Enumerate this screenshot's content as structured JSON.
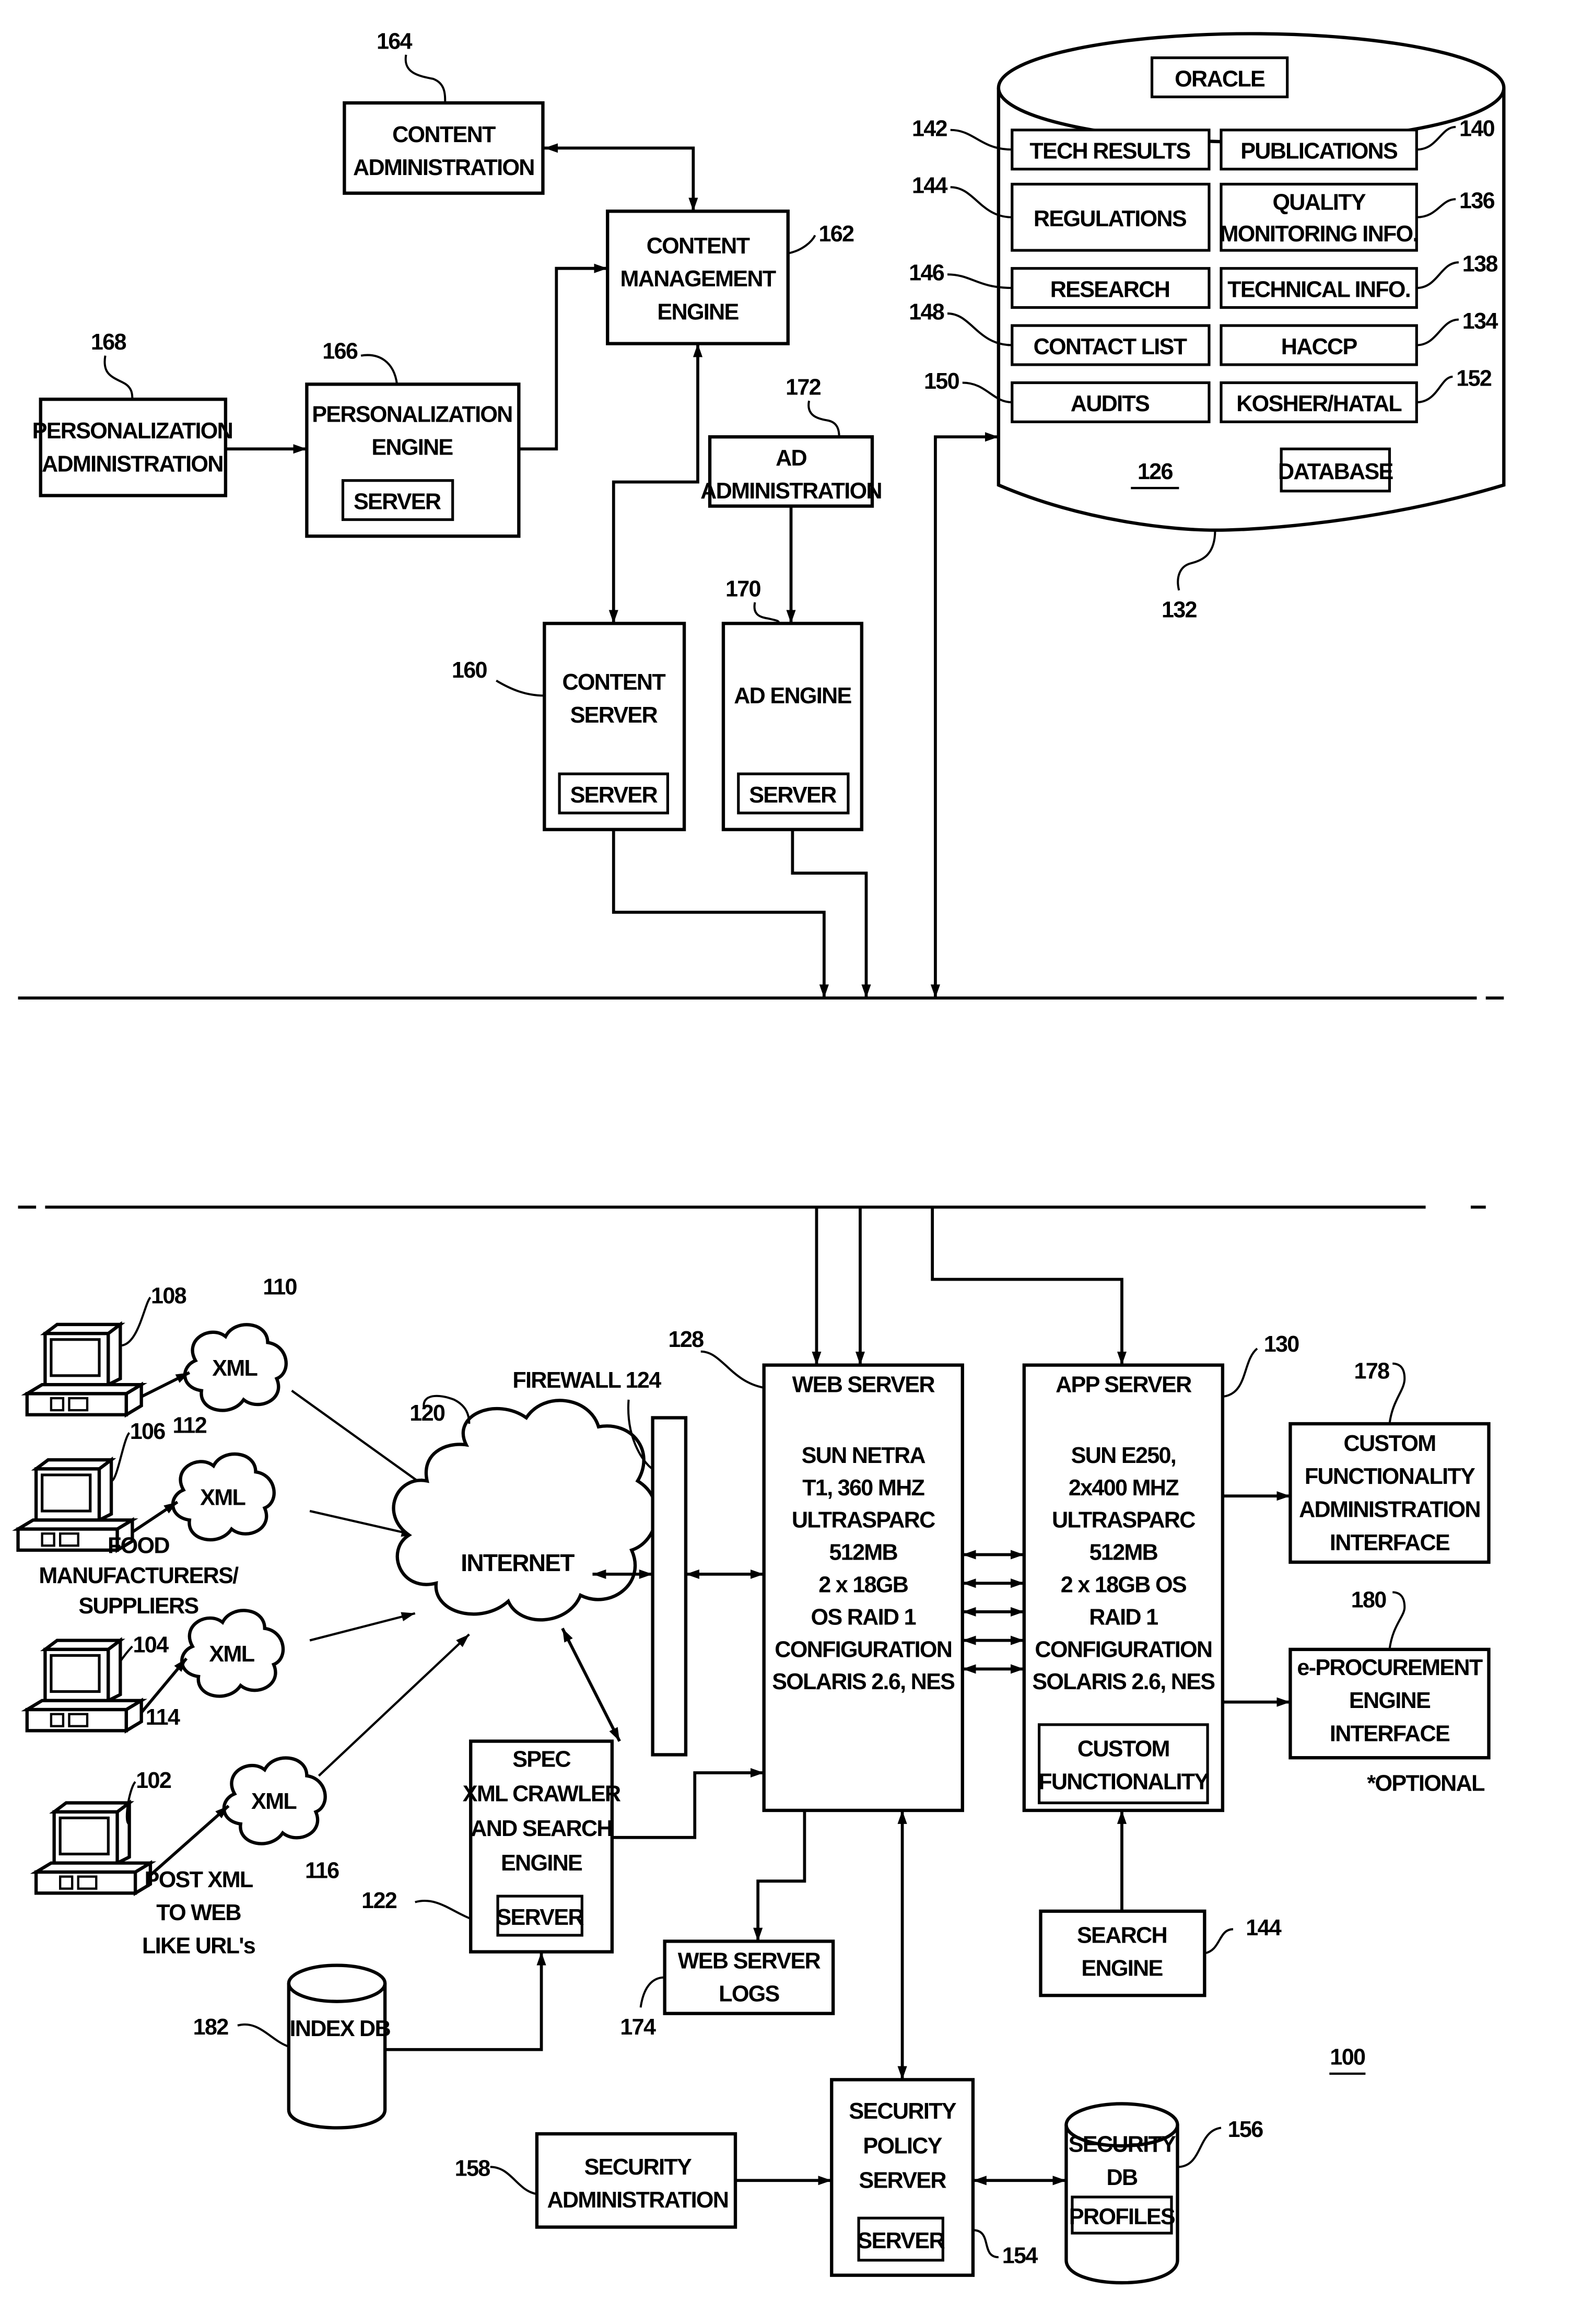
{
  "figure_number": "100",
  "upper": {
    "content_administration": {
      "ref": "164",
      "lines": [
        "CONTENT",
        "ADMINISTRATION"
      ]
    },
    "content_management_engine": {
      "ref": "162",
      "lines": [
        "CONTENT",
        "MANAGEMENT",
        "ENGINE"
      ]
    },
    "personalization_administration": {
      "ref": "168",
      "lines": [
        "PERSONALIZATION",
        "ADMINISTRATION"
      ]
    },
    "personalization_engine": {
      "ref": "166",
      "lines": [
        "PERSONALIZATION",
        "ENGINE"
      ],
      "server_label": "SERVER"
    },
    "ad_administration": {
      "ref": "172",
      "lines": [
        "AD",
        "ADMINISTRATION"
      ]
    },
    "content_server": {
      "ref": "160",
      "lines": [
        "CONTENT",
        "SERVER"
      ],
      "server_label": "SERVER"
    },
    "ad_engine": {
      "ref": "170",
      "lines": [
        "AD ENGINE"
      ],
      "server_label": "SERVER"
    },
    "database": {
      "ref": "126",
      "cylinder_ref": "132",
      "top_label": "ORACLE",
      "bottom_label": "DATABASE",
      "left_items": [
        {
          "label": [
            "TECH RESULTS"
          ],
          "ref": "142"
        },
        {
          "label": [
            "REGULATIONS"
          ],
          "ref": "144"
        },
        {
          "label": [
            "RESEARCH"
          ],
          "ref": "146"
        },
        {
          "label": [
            "CONTACT LIST"
          ],
          "ref": "148"
        },
        {
          "label": [
            "AUDITS"
          ],
          "ref": "150"
        }
      ],
      "right_items": [
        {
          "label": [
            "PUBLICATIONS"
          ],
          "ref": "140"
        },
        {
          "label": [
            "QUALITY",
            "MONITORING INFO."
          ],
          "ref": "136"
        },
        {
          "label": [
            "TECHNICAL INFO."
          ],
          "ref": "138"
        },
        {
          "label": [
            "HACCP"
          ],
          "ref": "134"
        },
        {
          "label": [
            "KOSHER/HATAL"
          ],
          "ref": "152"
        }
      ]
    }
  },
  "lower": {
    "clients": [
      {
        "ref": "108",
        "cloud_ref": "110",
        "cloud_label": "XML"
      },
      {
        "ref": "106",
        "cloud_ref": "112",
        "cloud_label": "XML"
      },
      {
        "ref": "104",
        "cloud_ref": "114",
        "cloud_label": "XML"
      },
      {
        "ref": "102",
        "cloud_ref": "116",
        "cloud_label": "XML"
      }
    ],
    "food_label": [
      "FOOD",
      "MANUFACTURERS/",
      "SUPPLIERS"
    ],
    "post_label": [
      "POST XML",
      "TO WEB",
      "LIKE URL's"
    ],
    "internet": {
      "ref": "120",
      "label": "INTERNET"
    },
    "firewall": {
      "label": "FIREWALL 124"
    },
    "web_server": {
      "ref": "128",
      "title": "WEB SERVER",
      "specs": [
        "SUN NETRA",
        "T1, 360 MHZ",
        "ULTRASPARC",
        "512MB",
        "2 x 18GB",
        "OS RAID 1",
        "CONFIGURATION",
        "SOLARIS 2.6, NES"
      ]
    },
    "app_server": {
      "ref": "130",
      "title": "APP SERVER",
      "specs": [
        "SUN E250,",
        "2x400 MHZ",
        "ULTRASPARC",
        "512MB",
        "2 x 18GB OS",
        "RAID 1",
        "CONFIGURATION",
        "SOLARIS 2.6, NES"
      ],
      "custom_label": [
        "CUSTOM",
        "FUNCTIONALITY"
      ]
    },
    "custom_admin": {
      "ref": "178",
      "lines": [
        "CUSTOM",
        "FUNCTIONALITY",
        "ADMINISTRATION",
        "INTERFACE"
      ]
    },
    "eprocurement": {
      "ref": "180",
      "lines": [
        "e-PROCUREMENT",
        "ENGINE",
        "INTERFACE"
      ],
      "note": "*OPTIONAL"
    },
    "spec_crawler": {
      "ref": "122",
      "lines": [
        "SPEC",
        "XML CRAWLER",
        "AND SEARCH",
        "ENGINE"
      ],
      "server_label": "SERVER"
    },
    "index_db": {
      "ref": "182",
      "label": "INDEX DB"
    },
    "web_server_logs": {
      "ref": "174",
      "lines": [
        "WEB SERVER",
        "LOGS"
      ]
    },
    "search_engine": {
      "ref": "144",
      "lines": [
        "SEARCH",
        "ENGINE"
      ]
    },
    "security_admin": {
      "ref": "158",
      "lines": [
        "SECURITY",
        "ADMINISTRATION"
      ]
    },
    "security_policy_server": {
      "ref": "154",
      "lines": [
        "SECURITY",
        "POLICY",
        "SERVER"
      ],
      "server_label": "SERVER"
    },
    "security_db": {
      "ref": "156",
      "lines": [
        "SECURITY",
        "DB"
      ],
      "profiles_label": "PROFILES"
    }
  }
}
